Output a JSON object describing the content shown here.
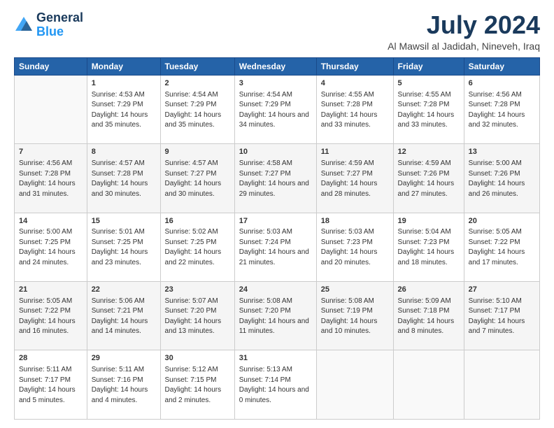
{
  "header": {
    "logo_line1": "General",
    "logo_line2": "Blue",
    "title": "July 2024",
    "subtitle": "Al Mawsil al Jadidah, Nineveh, Iraq"
  },
  "weekdays": [
    "Sunday",
    "Monday",
    "Tuesday",
    "Wednesday",
    "Thursday",
    "Friday",
    "Saturday"
  ],
  "weeks": [
    [
      {
        "day": "",
        "sunrise": "",
        "sunset": "",
        "daylight": ""
      },
      {
        "day": "1",
        "sunrise": "Sunrise: 4:53 AM",
        "sunset": "Sunset: 7:29 PM",
        "daylight": "Daylight: 14 hours and 35 minutes."
      },
      {
        "day": "2",
        "sunrise": "Sunrise: 4:54 AM",
        "sunset": "Sunset: 7:29 PM",
        "daylight": "Daylight: 14 hours and 35 minutes."
      },
      {
        "day": "3",
        "sunrise": "Sunrise: 4:54 AM",
        "sunset": "Sunset: 7:29 PM",
        "daylight": "Daylight: 14 hours and 34 minutes."
      },
      {
        "day": "4",
        "sunrise": "Sunrise: 4:55 AM",
        "sunset": "Sunset: 7:28 PM",
        "daylight": "Daylight: 14 hours and 33 minutes."
      },
      {
        "day": "5",
        "sunrise": "Sunrise: 4:55 AM",
        "sunset": "Sunset: 7:28 PM",
        "daylight": "Daylight: 14 hours and 33 minutes."
      },
      {
        "day": "6",
        "sunrise": "Sunrise: 4:56 AM",
        "sunset": "Sunset: 7:28 PM",
        "daylight": "Daylight: 14 hours and 32 minutes."
      }
    ],
    [
      {
        "day": "7",
        "sunrise": "Sunrise: 4:56 AM",
        "sunset": "Sunset: 7:28 PM",
        "daylight": "Daylight: 14 hours and 31 minutes."
      },
      {
        "day": "8",
        "sunrise": "Sunrise: 4:57 AM",
        "sunset": "Sunset: 7:28 PM",
        "daylight": "Daylight: 14 hours and 30 minutes."
      },
      {
        "day": "9",
        "sunrise": "Sunrise: 4:57 AM",
        "sunset": "Sunset: 7:27 PM",
        "daylight": "Daylight: 14 hours and 30 minutes."
      },
      {
        "day": "10",
        "sunrise": "Sunrise: 4:58 AM",
        "sunset": "Sunset: 7:27 PM",
        "daylight": "Daylight: 14 hours and 29 minutes."
      },
      {
        "day": "11",
        "sunrise": "Sunrise: 4:59 AM",
        "sunset": "Sunset: 7:27 PM",
        "daylight": "Daylight: 14 hours and 28 minutes."
      },
      {
        "day": "12",
        "sunrise": "Sunrise: 4:59 AM",
        "sunset": "Sunset: 7:26 PM",
        "daylight": "Daylight: 14 hours and 27 minutes."
      },
      {
        "day": "13",
        "sunrise": "Sunrise: 5:00 AM",
        "sunset": "Sunset: 7:26 PM",
        "daylight": "Daylight: 14 hours and 26 minutes."
      }
    ],
    [
      {
        "day": "14",
        "sunrise": "Sunrise: 5:00 AM",
        "sunset": "Sunset: 7:25 PM",
        "daylight": "Daylight: 14 hours and 24 minutes."
      },
      {
        "day": "15",
        "sunrise": "Sunrise: 5:01 AM",
        "sunset": "Sunset: 7:25 PM",
        "daylight": "Daylight: 14 hours and 23 minutes."
      },
      {
        "day": "16",
        "sunrise": "Sunrise: 5:02 AM",
        "sunset": "Sunset: 7:25 PM",
        "daylight": "Daylight: 14 hours and 22 minutes."
      },
      {
        "day": "17",
        "sunrise": "Sunrise: 5:03 AM",
        "sunset": "Sunset: 7:24 PM",
        "daylight": "Daylight: 14 hours and 21 minutes."
      },
      {
        "day": "18",
        "sunrise": "Sunrise: 5:03 AM",
        "sunset": "Sunset: 7:23 PM",
        "daylight": "Daylight: 14 hours and 20 minutes."
      },
      {
        "day": "19",
        "sunrise": "Sunrise: 5:04 AM",
        "sunset": "Sunset: 7:23 PM",
        "daylight": "Daylight: 14 hours and 18 minutes."
      },
      {
        "day": "20",
        "sunrise": "Sunrise: 5:05 AM",
        "sunset": "Sunset: 7:22 PM",
        "daylight": "Daylight: 14 hours and 17 minutes."
      }
    ],
    [
      {
        "day": "21",
        "sunrise": "Sunrise: 5:05 AM",
        "sunset": "Sunset: 7:22 PM",
        "daylight": "Daylight: 14 hours and 16 minutes."
      },
      {
        "day": "22",
        "sunrise": "Sunrise: 5:06 AM",
        "sunset": "Sunset: 7:21 PM",
        "daylight": "Daylight: 14 hours and 14 minutes."
      },
      {
        "day": "23",
        "sunrise": "Sunrise: 5:07 AM",
        "sunset": "Sunset: 7:20 PM",
        "daylight": "Daylight: 14 hours and 13 minutes."
      },
      {
        "day": "24",
        "sunrise": "Sunrise: 5:08 AM",
        "sunset": "Sunset: 7:20 PM",
        "daylight": "Daylight: 14 hours and 11 minutes."
      },
      {
        "day": "25",
        "sunrise": "Sunrise: 5:08 AM",
        "sunset": "Sunset: 7:19 PM",
        "daylight": "Daylight: 14 hours and 10 minutes."
      },
      {
        "day": "26",
        "sunrise": "Sunrise: 5:09 AM",
        "sunset": "Sunset: 7:18 PM",
        "daylight": "Daylight: 14 hours and 8 minutes."
      },
      {
        "day": "27",
        "sunrise": "Sunrise: 5:10 AM",
        "sunset": "Sunset: 7:17 PM",
        "daylight": "Daylight: 14 hours and 7 minutes."
      }
    ],
    [
      {
        "day": "28",
        "sunrise": "Sunrise: 5:11 AM",
        "sunset": "Sunset: 7:17 PM",
        "daylight": "Daylight: 14 hours and 5 minutes."
      },
      {
        "day": "29",
        "sunrise": "Sunrise: 5:11 AM",
        "sunset": "Sunset: 7:16 PM",
        "daylight": "Daylight: 14 hours and 4 minutes."
      },
      {
        "day": "30",
        "sunrise": "Sunrise: 5:12 AM",
        "sunset": "Sunset: 7:15 PM",
        "daylight": "Daylight: 14 hours and 2 minutes."
      },
      {
        "day": "31",
        "sunrise": "Sunrise: 5:13 AM",
        "sunset": "Sunset: 7:14 PM",
        "daylight": "Daylight: 14 hours and 0 minutes."
      },
      {
        "day": "",
        "sunrise": "",
        "sunset": "",
        "daylight": ""
      },
      {
        "day": "",
        "sunrise": "",
        "sunset": "",
        "daylight": ""
      },
      {
        "day": "",
        "sunrise": "",
        "sunset": "",
        "daylight": ""
      }
    ]
  ]
}
